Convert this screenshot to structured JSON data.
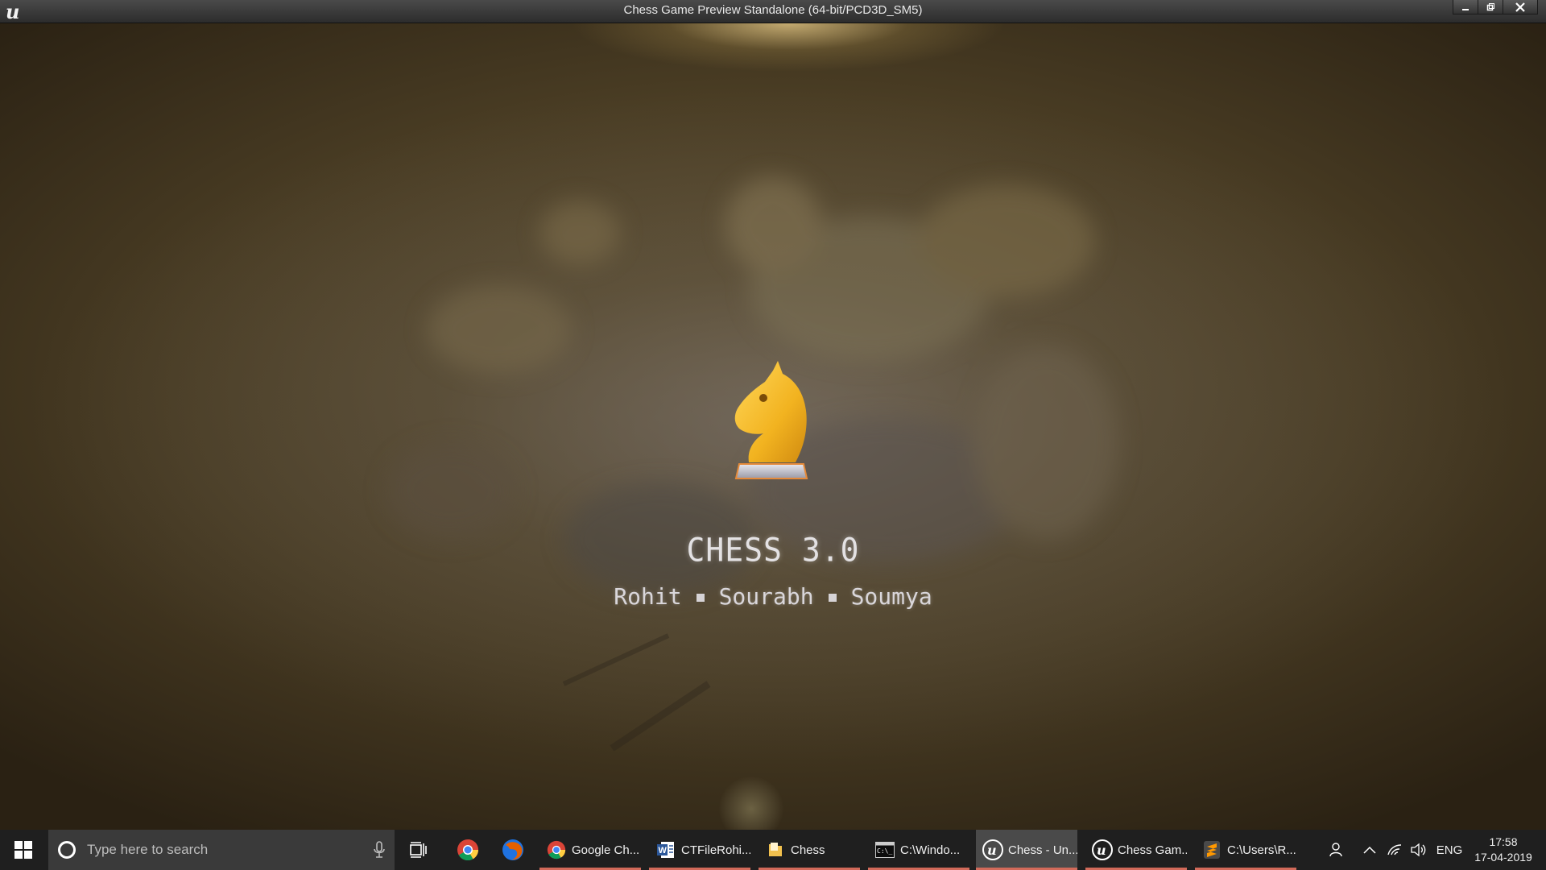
{
  "window": {
    "title": "Chess Game Preview Standalone (64-bit/PCD3D_SM5)",
    "app_icon": "unreal-engine-icon",
    "controls": [
      "minimize-icon",
      "restore-icon",
      "close-icon"
    ]
  },
  "splash": {
    "logo": "chess-knight-icon",
    "title": "CHESS 3.0",
    "credits": [
      "Rohit",
      "Sourabh",
      "Soumya"
    ],
    "colors": {
      "knight": "#f2b320",
      "knight_base": "#b8b8c0",
      "text": "#e3e1e3"
    }
  },
  "taskbar": {
    "start_icon": "windows-icon",
    "search": {
      "placeholder": "Type here to search",
      "icon": "cortana-icon",
      "mic": "microphone-icon"
    },
    "task_view_icon": "task-view-icon",
    "pinned": [
      {
        "name": "chrome",
        "icon": "chrome-icon"
      },
      {
        "name": "firefox",
        "icon": "firefox-icon"
      }
    ],
    "apps": [
      {
        "label": "Google Ch...",
        "icon": "chrome-icon"
      },
      {
        "label": "CTFileRohi...",
        "icon": "word-icon"
      },
      {
        "label": "Chess",
        "icon": "folder-icon"
      },
      {
        "label": "C:\\Windo...",
        "icon": "cmd-icon"
      },
      {
        "label": "Chess - Un...",
        "icon": "unreal-engine-icon",
        "active": true
      },
      {
        "label": "Chess Gam...",
        "icon": "unreal-engine-icon"
      },
      {
        "label": "C:\\Users\\R...",
        "icon": "sublime-text-icon"
      }
    ],
    "tray": {
      "people_icon": "people-icon",
      "chevron_icon": "chevron-up-icon",
      "network_icon": "wifi-icon",
      "volume_icon": "volume-icon",
      "language": "ENG",
      "time": "17:58",
      "date": "17-04-2019"
    },
    "accent_underline": "#d26a5a"
  }
}
